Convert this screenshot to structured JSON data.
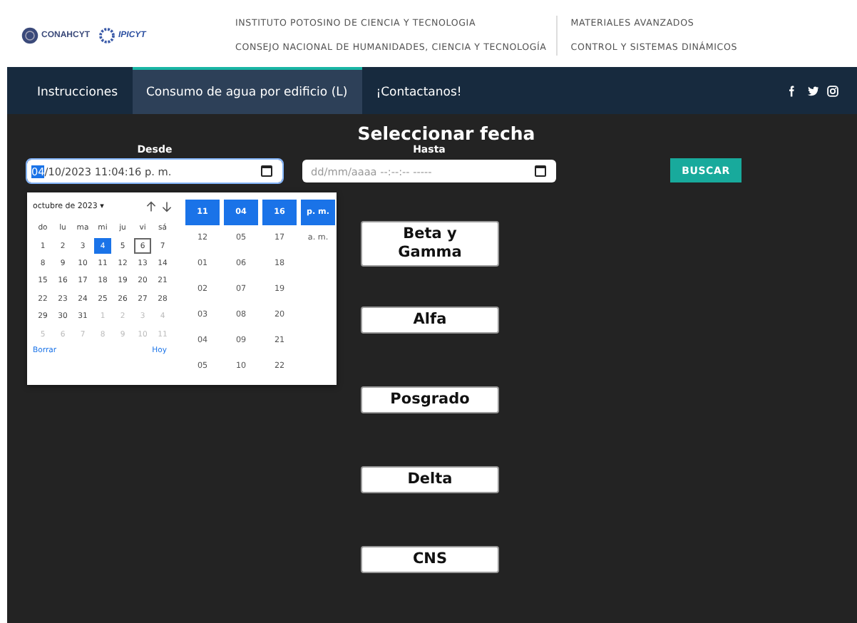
{
  "header": {
    "logos": [
      "CONAHCYT",
      "IPICYT"
    ],
    "institutes": [
      "INSTITUTO POTOSINO DE CIENCIA Y TECNOLOGIA",
      "CONSEJO NACIONAL DE HUMANIDADES, CIENCIA Y TECNOLOGÍA"
    ],
    "departments": [
      "MATERIALES AVANZADOS",
      "CONTROL Y SISTEMAS DINÁMICOS"
    ]
  },
  "nav": {
    "tabs": [
      {
        "label": "Instrucciones",
        "selected": false
      },
      {
        "label": "Consumo de agua por edificio (L)",
        "selected": true
      },
      {
        "label": "¡Contactanos!",
        "selected": false
      }
    ],
    "social": [
      {
        "kind": "facebook"
      },
      {
        "kind": "twitter"
      },
      {
        "kind": "instagram"
      }
    ]
  },
  "title": "Seleccionar fecha",
  "from": {
    "label": "Desde",
    "segments": [
      {
        "text": "04",
        "selected": true
      },
      {
        "text": "/10/2023 11:04:16 p. m.",
        "selected": false
      }
    ]
  },
  "to": {
    "label": "Hasta",
    "placeholder": "dd/mm/aaaa --:--:-- -----"
  },
  "search_button": "BUSCAR",
  "picker": {
    "month": "octubre de 2023 ▾",
    "weekdays": [
      "do",
      "lu",
      "ma",
      "mi",
      "ju",
      "vi",
      "sá"
    ],
    "days": [
      {
        "label": "1",
        "selected": false,
        "today": false,
        "outside": false
      },
      {
        "label": "2",
        "selected": false,
        "today": false,
        "outside": false
      },
      {
        "label": "3",
        "selected": false,
        "today": false,
        "outside": false
      },
      {
        "label": "4",
        "selected": true,
        "today": false,
        "outside": false
      },
      {
        "label": "5",
        "selected": false,
        "today": false,
        "outside": false
      },
      {
        "label": "6",
        "selected": false,
        "today": true,
        "outside": false
      },
      {
        "label": "7",
        "selected": false,
        "today": false,
        "outside": false
      },
      {
        "label": "8",
        "selected": false,
        "today": false,
        "outside": false
      },
      {
        "label": "9",
        "selected": false,
        "today": false,
        "outside": false
      },
      {
        "label": "10",
        "selected": false,
        "today": false,
        "outside": false
      },
      {
        "label": "11",
        "selected": false,
        "today": false,
        "outside": false
      },
      {
        "label": "12",
        "selected": false,
        "today": false,
        "outside": false
      },
      {
        "label": "13",
        "selected": false,
        "today": false,
        "outside": false
      },
      {
        "label": "14",
        "selected": false,
        "today": false,
        "outside": false
      },
      {
        "label": "15",
        "selected": false,
        "today": false,
        "outside": false
      },
      {
        "label": "16",
        "selected": false,
        "today": false,
        "outside": false
      },
      {
        "label": "17",
        "selected": false,
        "today": false,
        "outside": false
      },
      {
        "label": "18",
        "selected": false,
        "today": false,
        "outside": false
      },
      {
        "label": "19",
        "selected": false,
        "today": false,
        "outside": false
      },
      {
        "label": "20",
        "selected": false,
        "today": false,
        "outside": false
      },
      {
        "label": "21",
        "selected": false,
        "today": false,
        "outside": false
      },
      {
        "label": "22",
        "selected": false,
        "today": false,
        "outside": false
      },
      {
        "label": "23",
        "selected": false,
        "today": false,
        "outside": false
      },
      {
        "label": "24",
        "selected": false,
        "today": false,
        "outside": false
      },
      {
        "label": "25",
        "selected": false,
        "today": false,
        "outside": false
      },
      {
        "label": "26",
        "selected": false,
        "today": false,
        "outside": false
      },
      {
        "label": "27",
        "selected": false,
        "today": false,
        "outside": false
      },
      {
        "label": "28",
        "selected": false,
        "today": false,
        "outside": false
      },
      {
        "label": "29",
        "selected": false,
        "today": false,
        "outside": false
      },
      {
        "label": "30",
        "selected": false,
        "today": false,
        "outside": false
      },
      {
        "label": "31",
        "selected": false,
        "today": false,
        "outside": false
      },
      {
        "label": "1",
        "selected": false,
        "today": false,
        "outside": true
      },
      {
        "label": "2",
        "selected": false,
        "today": false,
        "outside": true
      },
      {
        "label": "3",
        "selected": false,
        "today": false,
        "outside": true
      },
      {
        "label": "4",
        "selected": false,
        "today": false,
        "outside": true
      },
      {
        "label": "5",
        "selected": false,
        "today": false,
        "outside": true
      },
      {
        "label": "6",
        "selected": false,
        "today": false,
        "outside": true
      },
      {
        "label": "7",
        "selected": false,
        "today": false,
        "outside": true
      },
      {
        "label": "8",
        "selected": false,
        "today": false,
        "outside": true
      },
      {
        "label": "9",
        "selected": false,
        "today": false,
        "outside": true
      },
      {
        "label": "10",
        "selected": false,
        "today": false,
        "outside": true
      },
      {
        "label": "11",
        "selected": false,
        "today": false,
        "outside": true
      }
    ],
    "clear": "Borrar",
    "today": "Hoy",
    "time_columns": [
      [
        {
          "label": "11",
          "selected": true
        },
        {
          "label": "12",
          "selected": false
        },
        {
          "label": "01",
          "selected": false
        },
        {
          "label": "02",
          "selected": false
        },
        {
          "label": "03",
          "selected": false
        },
        {
          "label": "04",
          "selected": false
        },
        {
          "label": "05",
          "selected": false
        }
      ],
      [
        {
          "label": "04",
          "selected": true
        },
        {
          "label": "05",
          "selected": false
        },
        {
          "label": "06",
          "selected": false
        },
        {
          "label": "07",
          "selected": false
        },
        {
          "label": "08",
          "selected": false
        },
        {
          "label": "09",
          "selected": false
        },
        {
          "label": "10",
          "selected": false
        }
      ],
      [
        {
          "label": "16",
          "selected": true
        },
        {
          "label": "17",
          "selected": false
        },
        {
          "label": "18",
          "selected": false
        },
        {
          "label": "19",
          "selected": false
        },
        {
          "label": "20",
          "selected": false
        },
        {
          "label": "21",
          "selected": false
        },
        {
          "label": "22",
          "selected": false
        }
      ],
      [
        {
          "label": "p. m.",
          "selected": true
        },
        {
          "label": "a. m.",
          "selected": false
        }
      ]
    ]
  },
  "buildings": [
    "Beta y Gamma",
    "Alfa",
    "Posgrado",
    "Delta",
    "CNS"
  ]
}
